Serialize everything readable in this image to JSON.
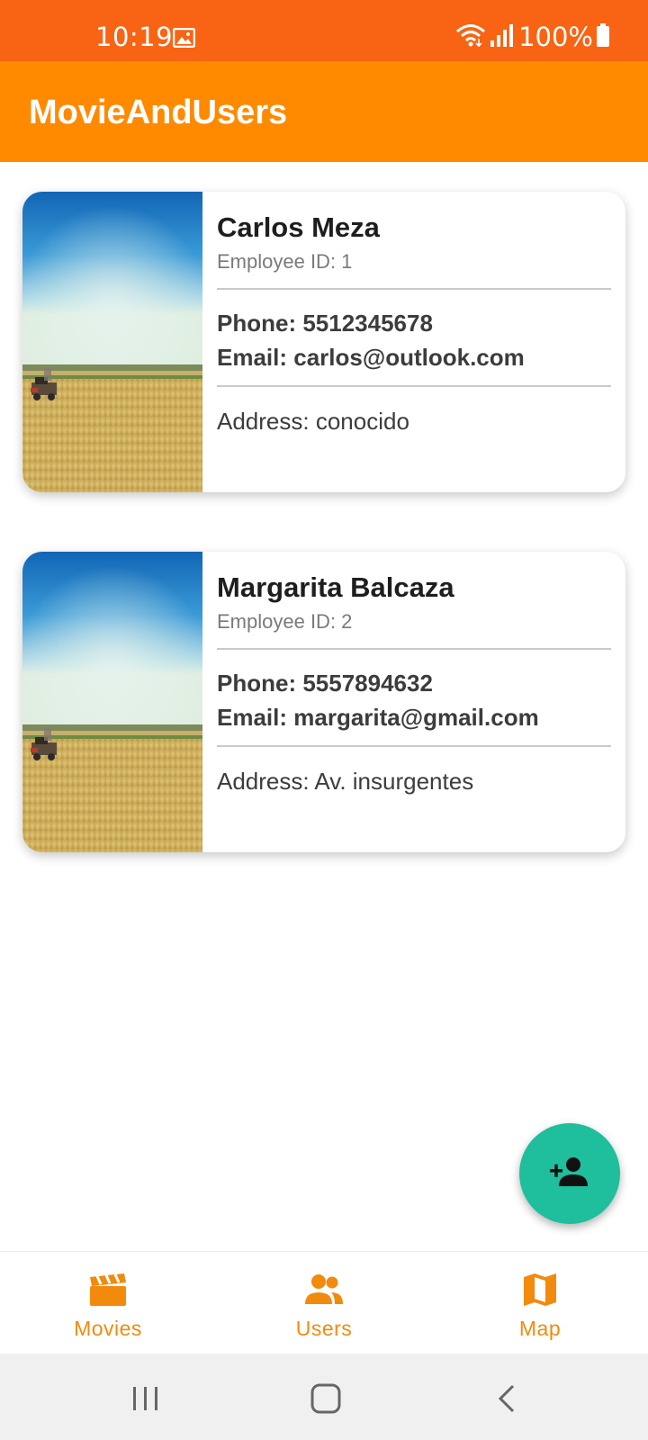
{
  "status_bar": {
    "time": "10:19",
    "battery": "100%",
    "icons": [
      "image-icon",
      "wifi-icon",
      "signal-icon",
      "battery-icon"
    ],
    "color": "#F86414"
  },
  "app_bar": {
    "title": "MovieAndUsers",
    "color": "#FF8A00"
  },
  "users": [
    {
      "name": "Carlos Meza",
      "employee_id": "Employee ID: 1",
      "phone": "Phone: 5512345678",
      "email": "Email: carlos@outlook.com",
      "address": "Address: conocido"
    },
    {
      "name": "Margarita Balcaza",
      "employee_id": "Employee ID: 2",
      "phone": "Phone: 5557894632",
      "email": "Email: margarita@gmail.com",
      "address": "Address: Av. insurgentes"
    }
  ],
  "fab": {
    "icon": "add-person-icon",
    "color": "#1FBE9C"
  },
  "bottom_nav": {
    "accent": "#F28A0E",
    "items": [
      {
        "label": "Movies",
        "icon": "clapperboard-icon"
      },
      {
        "label": "Users",
        "icon": "group-icon"
      },
      {
        "label": "Map",
        "icon": "map-icon"
      }
    ]
  },
  "system_nav": {
    "buttons": [
      "recents-icon",
      "home-icon",
      "back-icon"
    ]
  }
}
